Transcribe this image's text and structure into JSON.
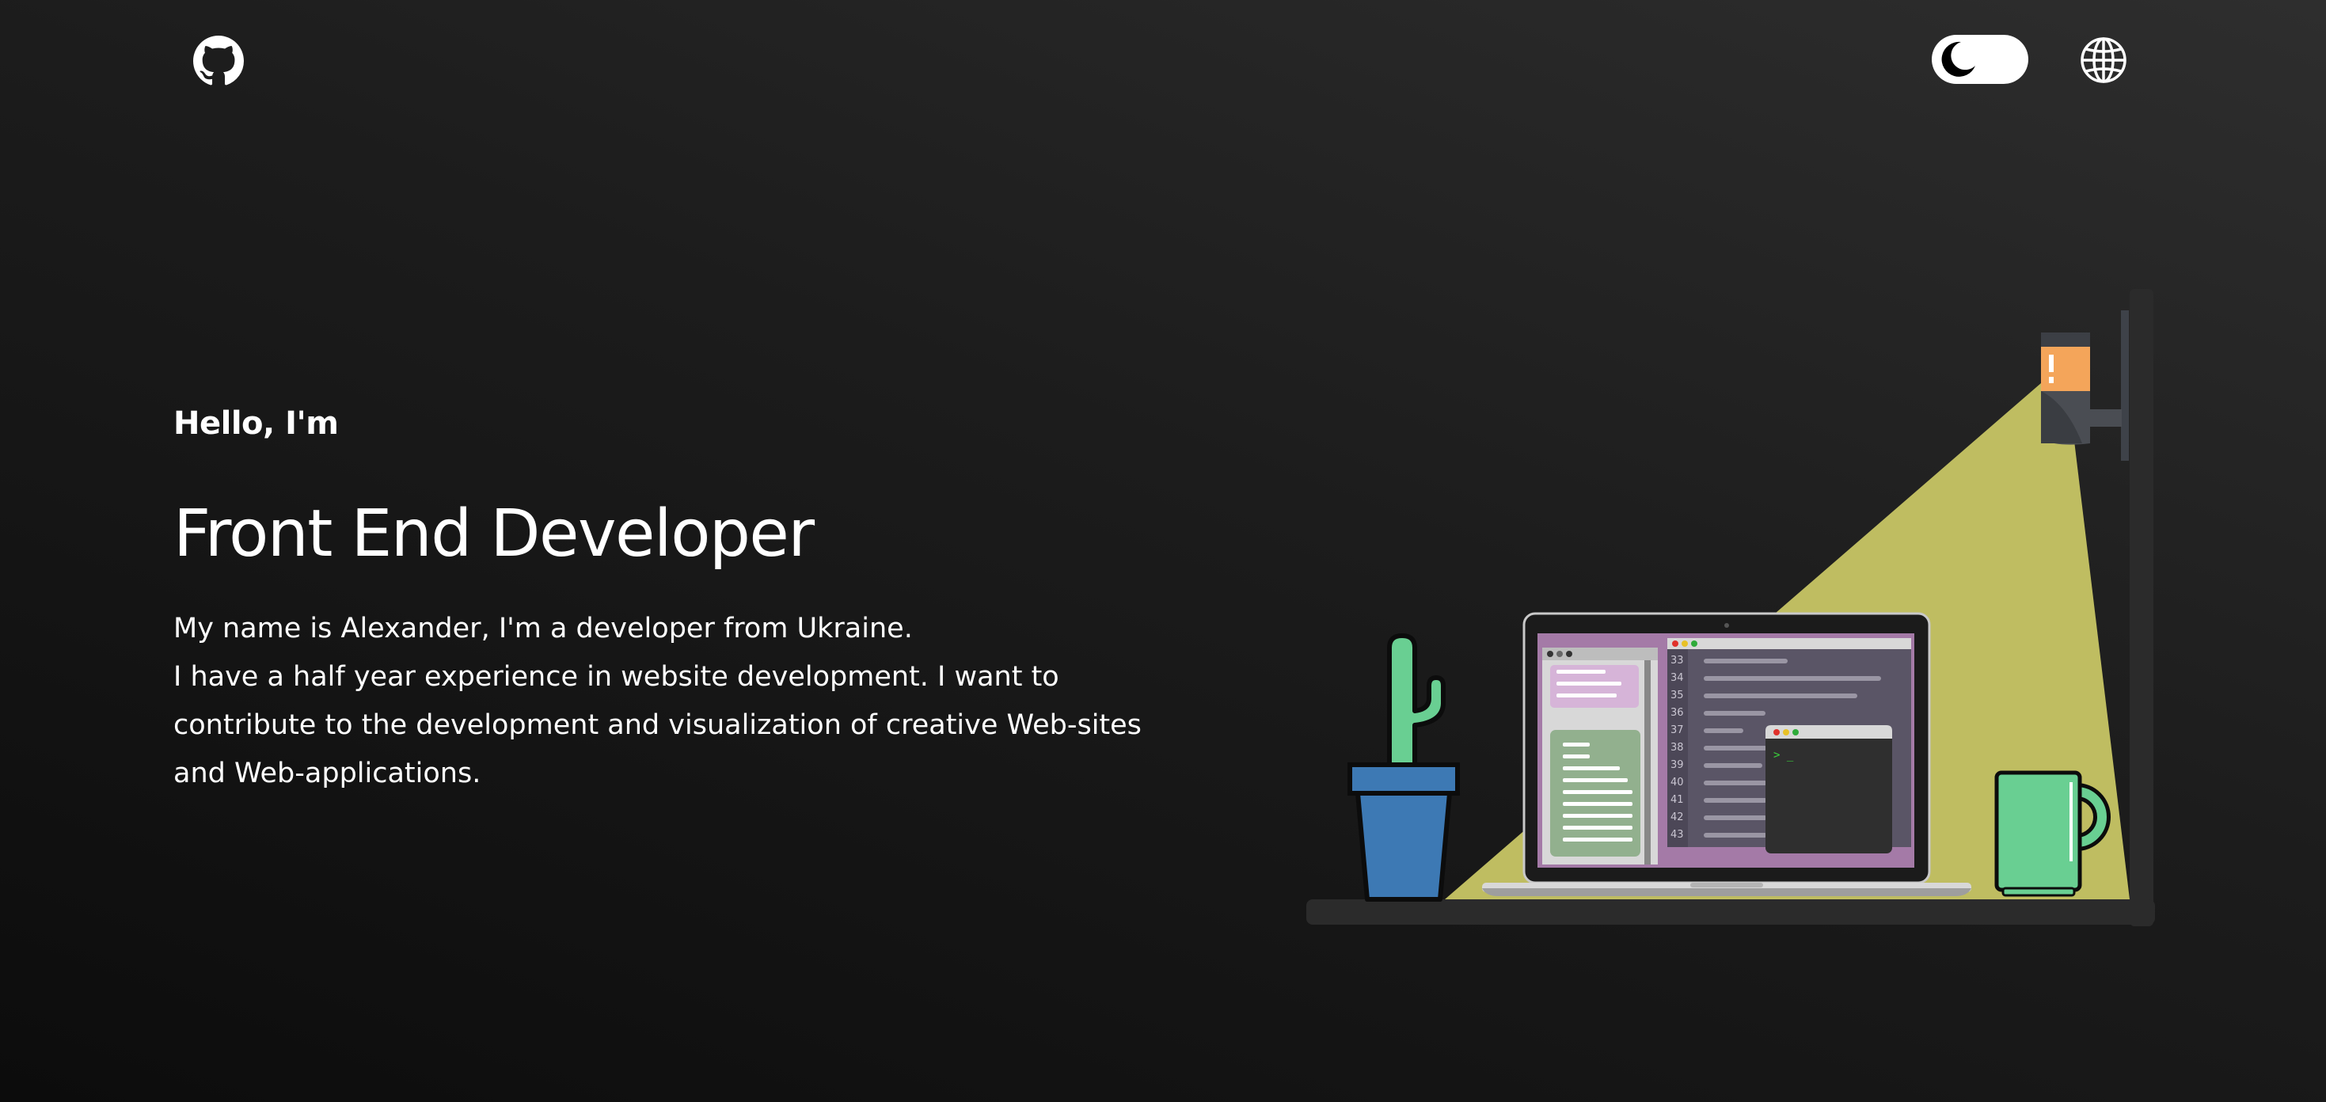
{
  "header": {
    "github_icon": "github-icon",
    "theme_toggle_icon": "moon-icon",
    "language_icon": "globe-icon"
  },
  "hero": {
    "greeting": "Hello, I'm",
    "title": "Front End Developer",
    "bio_line_1": "My name is Alexander, I'm a developer from Ukraine.",
    "bio_line_2": "I have a half year experience in website development. I want to contribute to the development and visualization of creative Web-sites and Web-applications."
  },
  "illustration": {
    "line_numbers": [
      "33",
      "34",
      "35",
      "36",
      "37",
      "38",
      "39",
      "40",
      "41",
      "42",
      "43"
    ],
    "terminal_prompt": "> _"
  },
  "colors": {
    "background_top": "#2e2e2e",
    "background_bottom": "#0c0c0c",
    "text": "#ffffff",
    "lamp_light": "#bfbd61",
    "cactus": "#69cf92",
    "pot": "#3d79b4",
    "mug": "#69cf92",
    "screen_purple": "#a47aa7"
  }
}
